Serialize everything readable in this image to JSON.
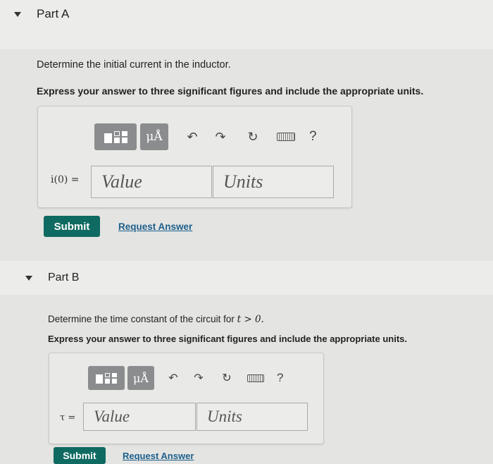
{
  "partA": {
    "title": "Part A",
    "question": "Determine the initial current in the inductor.",
    "instruction": "Express your answer to three significant figures and include the appropriate units.",
    "label": "i(0) =",
    "value_placeholder": "Value",
    "units_placeholder": "Units",
    "unit_button": "μÅ",
    "help": "?",
    "submit": "Submit",
    "request": "Request Answer"
  },
  "partB": {
    "title": "Part B",
    "question_prefix": "Determine the time constant of the circuit for ",
    "question_math": "t > 0.",
    "instruction": "Express your answer to three significant figures and include the appropriate units.",
    "label": "τ =",
    "value_placeholder": "Value",
    "units_placeholder": "Units",
    "unit_button": "μÅ",
    "help": "?",
    "submit": "Submit",
    "request": "Request Answer"
  },
  "colors": {
    "submit_bg": "#0f6a61",
    "link": "#1c5f8c",
    "toolbar_button": "#8a8c8e"
  },
  "icons": [
    "caret-down-icon",
    "templates-icon",
    "units-icon",
    "undo-icon",
    "redo-icon",
    "reset-icon",
    "keyboard-icon",
    "help-icon"
  ]
}
